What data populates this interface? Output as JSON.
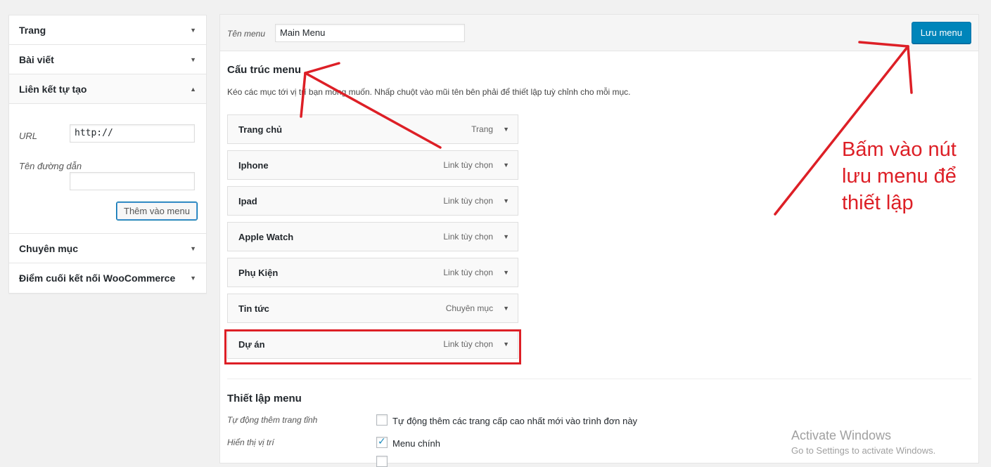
{
  "left_panel": {
    "sections": [
      {
        "label": "Trang"
      },
      {
        "label": "Bài viết"
      },
      {
        "label": "Liên kết tự tạo"
      },
      {
        "label": "Chuyên mục"
      },
      {
        "label": "Điểm cuối kết nối WooCommerce"
      }
    ],
    "custom_links": {
      "url_label": "URL",
      "url_value": "http://",
      "link_text_label": "Tên đường dẫn",
      "link_text_value": "",
      "add_button": "Thêm vào menu"
    }
  },
  "header": {
    "menu_name_label": "Tên menu",
    "menu_name_value": "Main Menu",
    "save_button": "Lưu menu"
  },
  "structure": {
    "title": "Cấu trúc menu",
    "description": "Kéo các mục tới vị trí bạn mong muốn. Nhấp chuột vào mũi tên bên phải để thiết lập tuỳ chỉnh cho mỗi mục.",
    "items": [
      {
        "title": "Trang chủ",
        "type": "Trang"
      },
      {
        "title": "Iphone",
        "type": "Link tùy chọn"
      },
      {
        "title": "Ipad",
        "type": "Link tùy chọn"
      },
      {
        "title": "Apple Watch",
        "type": "Link tùy chọn"
      },
      {
        "title": "Phụ Kiện",
        "type": "Link tùy chọn"
      },
      {
        "title": "Tin tức",
        "type": "Chuyên mục"
      },
      {
        "title": "Dự án",
        "type": "Link tùy chọn"
      }
    ]
  },
  "settings": {
    "title": "Thiết lập menu",
    "auto_add_label": "Tự động thêm trang tĩnh",
    "auto_add_option": "Tự động thêm các trang cấp cao nhất mới vào trình đơn này",
    "auto_add_checked": false,
    "location_label": "Hiển thị vị trí",
    "location_option": "Menu chính",
    "location_checked": true
  },
  "annotation": {
    "line1": "Bấm vào nút",
    "line2": "lưu menu để",
    "line3": "thiết lập",
    "color": "#dd1f26"
  },
  "watermark": {
    "title": "Activate Windows",
    "subtitle": "Go to Settings to activate Windows."
  },
  "colors": {
    "primary_button": "#0085ba",
    "highlight": "#dd1f26",
    "background": "#f1f1f1"
  }
}
